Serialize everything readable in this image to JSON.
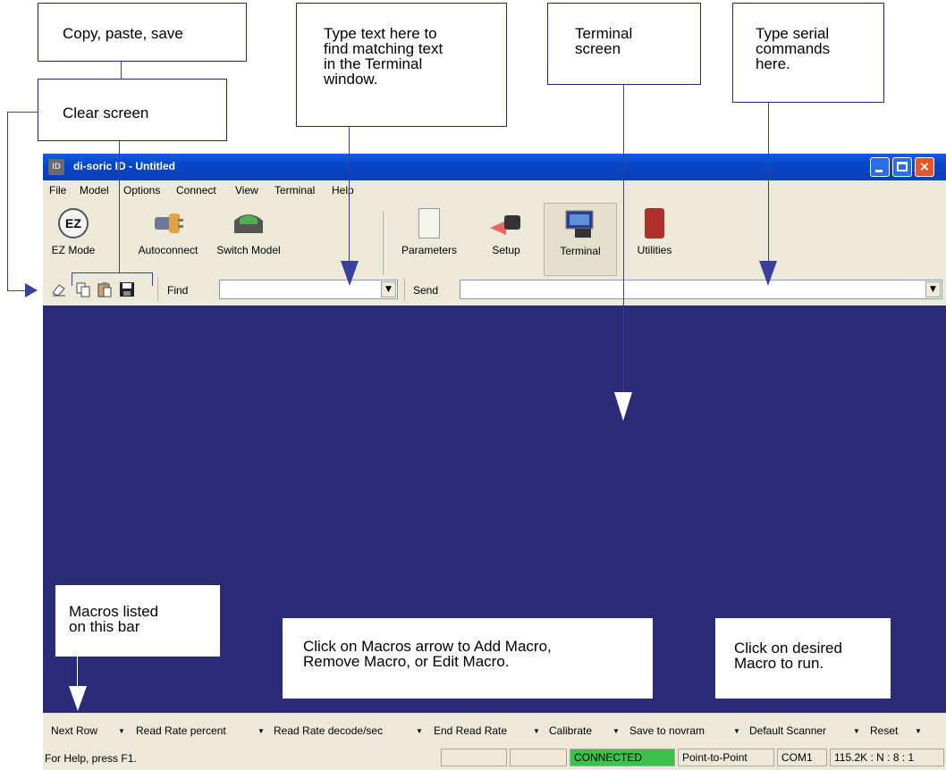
{
  "callouts": {
    "copy_paste_save": "Copy, paste, save",
    "clear_screen": "Clear screen",
    "find_text": [
      "Type text here to",
      "find matching text",
      "in the Terminal",
      "window."
    ],
    "terminal_screen": [
      "Terminal",
      "screen"
    ],
    "serial_commands": [
      "Type serial",
      "commands",
      "here."
    ],
    "macros_listed": [
      "Macros listed",
      "on this bar"
    ],
    "macros_arrow": [
      "Click on Macros arrow to Add Macro,",
      "Remove Macro, or Edit Macro."
    ],
    "desired_macro": [
      "Click on desired",
      "Macro to run."
    ]
  },
  "window": {
    "icon_text": "ID",
    "title": "di-soric ID - Untitled",
    "close_glyph": "×"
  },
  "menu": [
    "File",
    "Model",
    "Options",
    "Connect",
    "View",
    "Terminal",
    "Help"
  ],
  "toolbar": {
    "ez_mode": "EZ Mode",
    "ez_badge": "EZ",
    "autoconnect": "Autoconnect",
    "switch_model": "Switch Model",
    "parameters": "Parameters",
    "setup": "Setup",
    "terminal": "Terminal",
    "utilities": "Utilities"
  },
  "find": {
    "label": "Find",
    "value": ""
  },
  "send": {
    "label": "Send",
    "value": ""
  },
  "macros": [
    "Next Row",
    "Read Rate percent",
    "Read Rate decode/sec",
    "End Read Rate",
    "Calibrate",
    "Save to novram",
    "Default Scanner",
    "Reset"
  ],
  "macro_arrow_glyph": "▼",
  "status": {
    "help": "For Help, press F1.",
    "connected": "CONNECTED",
    "mode": "Point-to-Point",
    "port": "COM1",
    "settings": "115.2K : N : 8 : 1"
  },
  "colors": {
    "screen": "#2b2b7a",
    "titlebar": "#0846c9",
    "connected": "#3cc24a",
    "callout_border": "#1f2a7a"
  }
}
